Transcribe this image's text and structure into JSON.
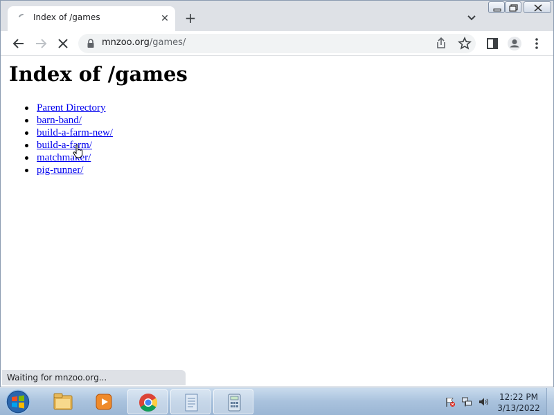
{
  "browser": {
    "tab": {
      "title": "Index of /games"
    },
    "omnibox": {
      "domain": "mnzoo.org",
      "path": "/games/"
    },
    "status_text": "Waiting for mnzoo.org..."
  },
  "page": {
    "heading": "Index of /games",
    "links": [
      {
        "label": "Parent Directory"
      },
      {
        "label": "barn-band/"
      },
      {
        "label": "build-a-farm-new/"
      },
      {
        "label": "build-a-farm/"
      },
      {
        "label": "matchmaker/"
      },
      {
        "label": "pig-runner/"
      }
    ]
  },
  "taskbar": {
    "apps": [
      "windows-explorer",
      "media-player",
      "chrome",
      "notepad",
      "calculator"
    ],
    "clock": {
      "time": "12:22 PM",
      "date": "3/13/2022"
    }
  }
}
